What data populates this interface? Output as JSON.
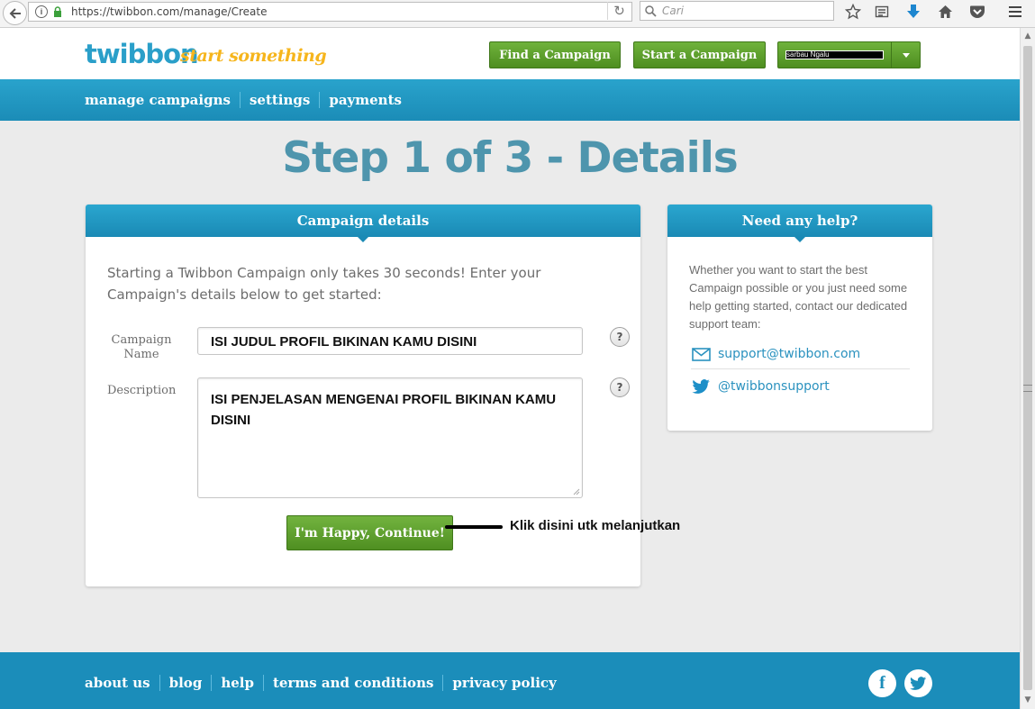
{
  "browser": {
    "url": "https://twibbon.com/manage/Create",
    "search_placeholder": "Cari"
  },
  "site": {
    "logo": "twibbon",
    "tagline": "start something",
    "buttons": {
      "find": "Find a Campaign",
      "start": "Start a Campaign",
      "user": "sarbau Ngalu"
    }
  },
  "subnav": {
    "items": [
      "manage campaigns",
      "settings",
      "payments"
    ]
  },
  "step_title": "Step 1 of 3 - Details",
  "campaign_panel": {
    "title": "Campaign details",
    "intro": "Starting a Twibbon Campaign only takes 30 seconds! Enter your Campaign's details below to get started:",
    "name_label": "Campaign Name",
    "name_value": "ISI JUDUL PROFIL BIKINAN KAMU DISINI",
    "description_label": "Description",
    "description_value": "ISI PENJELASAN MENGENAI PROFIL BIKINAN KAMU DISINI",
    "help_glyph": "?",
    "continue_label": "I'm Happy, Continue!"
  },
  "annotation": {
    "text": "Klik disini utk melanjutkan"
  },
  "help_panel": {
    "title": "Need any help?",
    "text": "Whether you want to start the best Campaign possible or you just need some help getting started, contact our dedicated support team:",
    "email": "support@twibbon.com",
    "twitter": "@twibbonsupport"
  },
  "footer": {
    "links": [
      "about us",
      "blog",
      "help",
      "terms and conditions",
      "privacy policy"
    ],
    "social_facebook": "f"
  },
  "colors": {
    "brand_blue": "#1b8dba",
    "button_green": "#5a9e2b",
    "title_blue": "#4e95ad",
    "tagline_yellow": "#f6b51c"
  },
  "icons": [
    "back-arrow-icon",
    "info-icon",
    "lock-icon",
    "reload-icon",
    "search-icon",
    "star-icon",
    "reading-list-icon",
    "download-icon",
    "home-icon",
    "pocket-icon",
    "menu-icon",
    "caret-down-icon",
    "question-icon",
    "mail-icon",
    "twitter-icon",
    "facebook-icon"
  ]
}
